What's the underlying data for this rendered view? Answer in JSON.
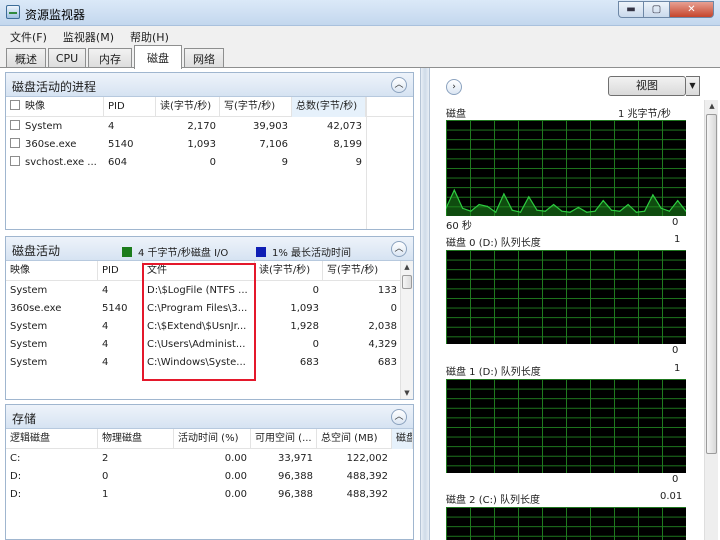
{
  "window": {
    "title": "资源监视器",
    "buttons": {
      "minimize": "▬",
      "maximize": "▢",
      "close": "✕"
    }
  },
  "menu": [
    "文件(F)",
    "监视器(M)",
    "帮助(H)"
  ],
  "tabs": [
    {
      "label": "概述",
      "active": false
    },
    {
      "label": "CPU",
      "active": false
    },
    {
      "label": "内存",
      "active": false
    },
    {
      "label": "磁盘",
      "active": true
    },
    {
      "label": "网络",
      "active": false
    }
  ],
  "processes": {
    "title": "磁盘活动的进程",
    "columns": [
      "映像",
      "PID",
      "读(字节/秒)",
      "写(字节/秒)",
      "总数(字节/秒)"
    ],
    "rows": [
      [
        "System",
        "4",
        "2,170",
        "39,903",
        "42,073"
      ],
      [
        "360se.exe",
        "5140",
        "1,093",
        "7,106",
        "8,199"
      ],
      [
        "svchost.exe ...",
        "604",
        "0",
        "9",
        "9"
      ]
    ]
  },
  "activity": {
    "title": "磁盘活动",
    "legend": [
      {
        "text": "4 千字节/秒磁盘 I/O",
        "color": "#1c7c1c"
      },
      {
        "text": "1% 最长活动时间",
        "color": "#0f1eb4"
      }
    ],
    "columns": [
      "映像",
      "PID",
      "文件",
      "读(字节/秒)",
      "写(字节/秒)"
    ],
    "rows": [
      [
        "System",
        "4",
        "D:\\$LogFile (NTFS ...",
        "0",
        "133"
      ],
      [
        "360se.exe",
        "5140",
        "C:\\Program Files\\3...",
        "1,093",
        "0"
      ],
      [
        "System",
        "4",
        "C:\\$Extend\\$UsnJr...",
        "1,928",
        "2,038"
      ],
      [
        "System",
        "4",
        "C:\\Users\\Administ...",
        "0",
        "4,329"
      ],
      [
        "System",
        "4",
        "C:\\Windows\\Syste...",
        "683",
        "683"
      ]
    ]
  },
  "storage": {
    "title": "存储",
    "columns": [
      "逻辑磁盘",
      "物理磁盘",
      "活动时间 (%)",
      "可用空间 (...",
      "总空间 (MB)",
      "磁盘"
    ],
    "rows": [
      [
        "C:",
        "2",
        "0.00",
        "33,971",
        "122,002"
      ],
      [
        "D:",
        "0",
        "0.00",
        "96,388",
        "488,392"
      ],
      [
        "D:",
        "1",
        "0.00",
        "96,388",
        "488,392"
      ]
    ]
  },
  "right": {
    "view_label": "视图",
    "disk_chart": {
      "title": "磁盘",
      "scale": "1 兆字节/秒",
      "left_bottom": "60 秒",
      "right_bottom": "0"
    },
    "queues": [
      {
        "title": "磁盘 0 (D:) 队列长度",
        "top": "1",
        "bottom": "0"
      },
      {
        "title": "磁盘 1 (D:) 队列长度",
        "top": "1",
        "bottom": "0"
      },
      {
        "title": "磁盘 2 (C:) 队列长度",
        "top": "0.01",
        "bottom": ""
      }
    ]
  },
  "chart_data": {
    "type": "line",
    "title": "磁盘",
    "series": [
      {
        "values": [
          0.08,
          0.27,
          0.08,
          0.05,
          0.12,
          0.1,
          0.04,
          0.23,
          0.06,
          0.04,
          0.2,
          0.06,
          0.05,
          0.12,
          0.05,
          0.04,
          0.09,
          0.04,
          0.05,
          0.16,
          0.06,
          0.05,
          0.12,
          0.04,
          0.05,
          0.22,
          0.08,
          0.05,
          0.16,
          0.05
        ]
      }
    ],
    "ylim": [
      0,
      1
    ],
    "colors": {
      "grid": "#1f7a1f",
      "line": "#2ecc40",
      "fill": "#1b8b1b"
    }
  },
  "icons": {
    "collapse": "chevron-up-icon",
    "expand": "chevron-right-icon",
    "dropdown": "chevron-down-icon"
  }
}
